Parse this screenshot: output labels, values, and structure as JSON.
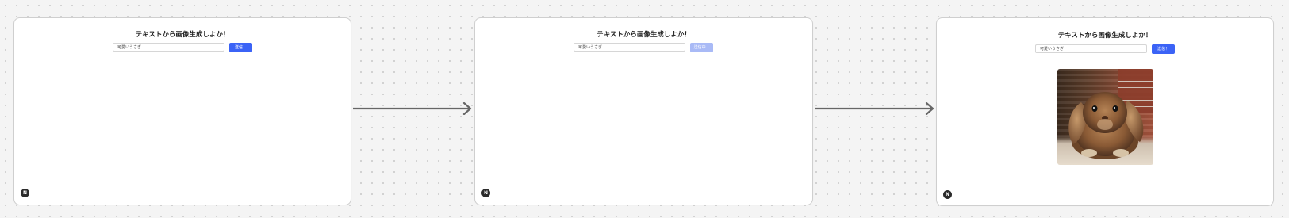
{
  "panels": [
    {
      "title": "テキストから画像生成しよか！",
      "input_value": "可愛いうさぎ",
      "button_label": "送信！",
      "button_state": "enabled",
      "fab_icon": "N",
      "image": null
    },
    {
      "title": "テキストから画像生成しよか！",
      "input_value": "可愛いうさぎ",
      "button_label": "送信中...",
      "button_state": "disabled",
      "fab_icon": "N",
      "image": null
    },
    {
      "title": "テキストから画像生成しよか！",
      "input_value": "可愛いうさぎ",
      "button_label": "送信！",
      "button_state": "enabled",
      "fab_icon": "N",
      "image": "rabbit-photo"
    }
  ],
  "colors": {
    "button": "#3b63f6",
    "button_disabled": "#a9baf6",
    "arrow": "#666666"
  }
}
